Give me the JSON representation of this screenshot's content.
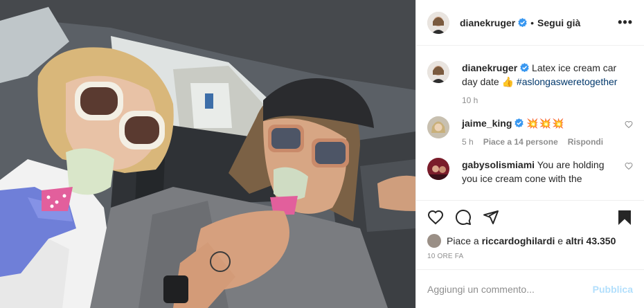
{
  "post": {
    "author": "dianekruger",
    "follow_status": "Segui già",
    "more_label": "•••"
  },
  "caption": {
    "username": "dianekruger",
    "text": "Latex ice cream car day date 👍",
    "hashtag": "#aslongasweretogether",
    "time": "10 h"
  },
  "comments": [
    {
      "username": "jaime_king",
      "text": "💥💥💥",
      "time": "5 h",
      "likes": "Piace a 14 persone",
      "reply": "Rispondi"
    },
    {
      "username": "gabysolismiami",
      "text": "You are holding you ice cream cone with the"
    }
  ],
  "likes": {
    "prefix": "Piace a",
    "user": "riccardoghilardi",
    "joiner": "e",
    "others": "altri 43.350"
  },
  "date": "10 ORE FA",
  "comment_box": {
    "placeholder": "Aggiungi un commento...",
    "publish_label": "Pubblica"
  },
  "colors": {
    "verified": "#3897f0",
    "link": "#00376b",
    "publish_disabled": "#b2dffc",
    "muted": "#8e8e8e"
  },
  "icons": [
    "heart-icon",
    "comment-icon",
    "share-icon",
    "bookmark-icon",
    "verified-badge-icon",
    "more-icon"
  ]
}
